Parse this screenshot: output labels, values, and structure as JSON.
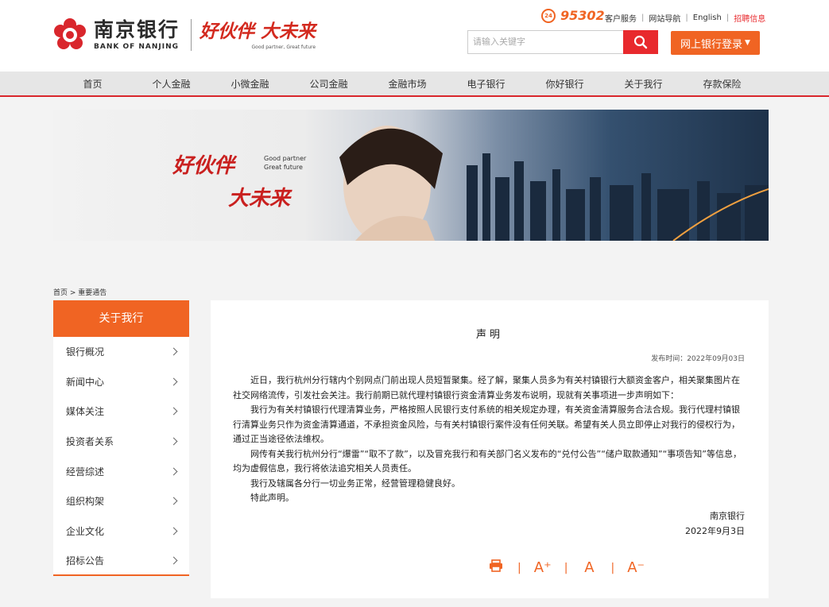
{
  "header": {
    "logo_cn": "南京银行",
    "logo_en": "BANK OF NANJING",
    "slogan_cn": "好伙伴 大未来",
    "slogan_en": "Good partner, Great future",
    "hotline_badge": "24",
    "hotline": "95302",
    "toplinks": [
      "客户服务",
      "网站导航",
      "English",
      "招聘信息"
    ],
    "search_placeholder": "请输入关键字",
    "login_label": "网上银行登录",
    "accent": "#f06423",
    "brand_red": "#e8292d"
  },
  "nav": {
    "items": [
      "首页",
      "个人金融",
      "小微金融",
      "公司金融",
      "金融市场",
      "电子银行",
      "你好银行",
      "关于我行",
      "存款保险"
    ]
  },
  "banner": {
    "cn_line1": "好伙伴",
    "cn_line2": "大未来",
    "en_line1": "Good partner",
    "en_line2": "Great future"
  },
  "breadcrumb": "首页 > 重要通告",
  "sidebar": {
    "title": "关于我行",
    "items": [
      "银行概况",
      "新闻中心",
      "媒体关注",
      "投资者关系",
      "经营综述",
      "组织构架",
      "企业文化",
      "招标公告"
    ]
  },
  "article": {
    "title": "声明",
    "date": "发布时间：2022年09月03日",
    "paragraphs": [
      "近日，我行杭州分行辖内个别网点门前出现人员短暂聚集。经了解，聚集人员多为有关村镇银行大额资金客户，相关聚集图片在社交网络流传，引发社会关注。我行前期已就代理村镇银行资金清算业务发布说明，现就有关事项进一步声明如下：",
      "我行为有关村镇银行代理清算业务，严格按照人民银行支付系统的相关规定办理，有关资金清算服务合法合规。我行代理村镇银行清算业务只作为资金清算通道，不承担资金风险，与有关村镇银行案件没有任何关联。希望有关人员立即停止对我行的侵权行为，通过正当途径依法维权。",
      "网传有关我行杭州分行“爆雷”“取不了款”，以及冒充我行和有关部门名义发布的“兑付公告”“储户取款通知”“事项告知”等信息，均为虚假信息，我行将依法追究相关人员责任。",
      "我行及辖属各分行一切业务正常，经营管理稳健良好。",
      "特此声明。"
    ],
    "signature": "南京银行",
    "sign_date": "2022年9月3日"
  },
  "tools": {
    "print": "print-icon",
    "font_up": "A⁺",
    "font_normal": "A",
    "font_down": "A⁻"
  }
}
